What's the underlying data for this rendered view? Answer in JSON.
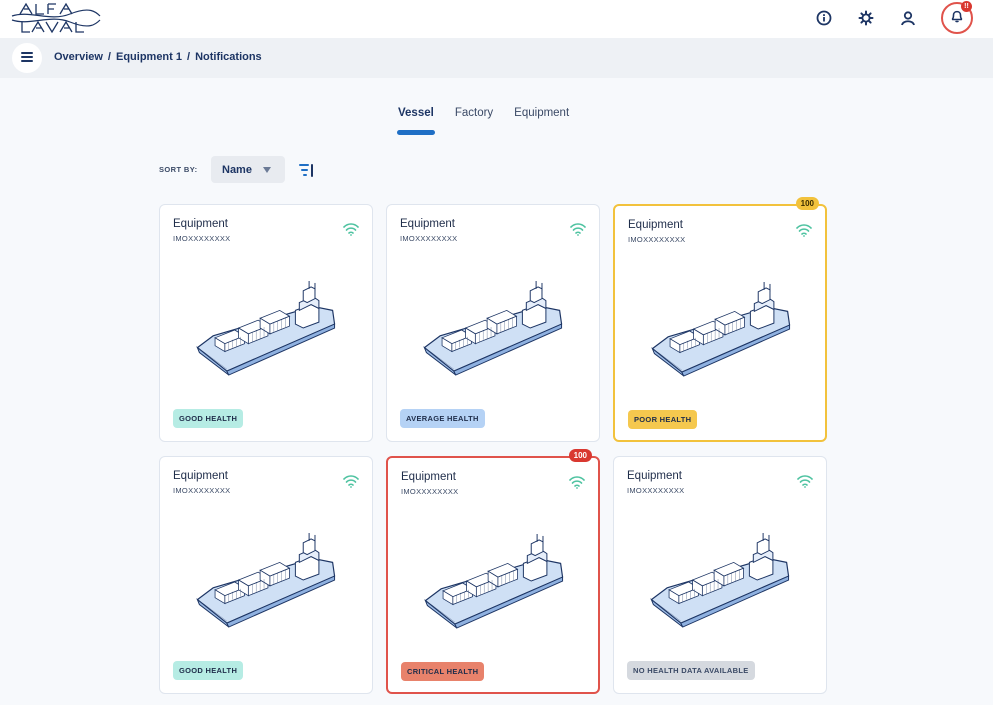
{
  "header": {
    "logo_text": "ALFA LAVAL",
    "notification_badge": "!!",
    "icons": [
      "info-icon",
      "settings-gear-icon",
      "user-icon",
      "bell-icon"
    ]
  },
  "breadcrumb": {
    "items": [
      "Overview",
      "Equipment 1",
      "Notifications"
    ],
    "separator": "/"
  },
  "tabs": [
    {
      "label": "Vessel",
      "active": true
    },
    {
      "label": "Factory",
      "active": false
    },
    {
      "label": "Equipment",
      "active": false
    }
  ],
  "sort": {
    "label": "SORT BY:",
    "selected": "Name"
  },
  "cards": [
    {
      "title": "Equipment",
      "subtitle": "IMOXXXXXXXX",
      "status": "GOOD HEALTH",
      "status_kind": "good",
      "badge": null
    },
    {
      "title": "Equipment",
      "subtitle": "IMOXXXXXXXX",
      "status": "AVERAGE HEALTH",
      "status_kind": "avg",
      "badge": null
    },
    {
      "title": "Equipment",
      "subtitle": "IMOXXXXXXXX",
      "status": "POOR HEALTH",
      "status_kind": "poor",
      "badge": "100"
    },
    {
      "title": "Equipment",
      "subtitle": "IMOXXXXXXXX",
      "status": "GOOD HEALTH",
      "status_kind": "good",
      "badge": null
    },
    {
      "title": "Equipment",
      "subtitle": "IMOXXXXXXXX",
      "status": "CRITICAL HEALTH",
      "status_kind": "critical",
      "badge": "100"
    },
    {
      "title": "Equipment",
      "subtitle": "IMOXXXXXXXX",
      "status": "NO HEALTH DATA AVAILABLE",
      "status_kind": "nodata",
      "badge": null
    }
  ],
  "colors": {
    "brand_blue": "#1d3564",
    "accent_blue": "#1f6fc5",
    "warning": "#f2c23c",
    "critical": "#e0534b",
    "signal_green": "#4fc3a1"
  }
}
